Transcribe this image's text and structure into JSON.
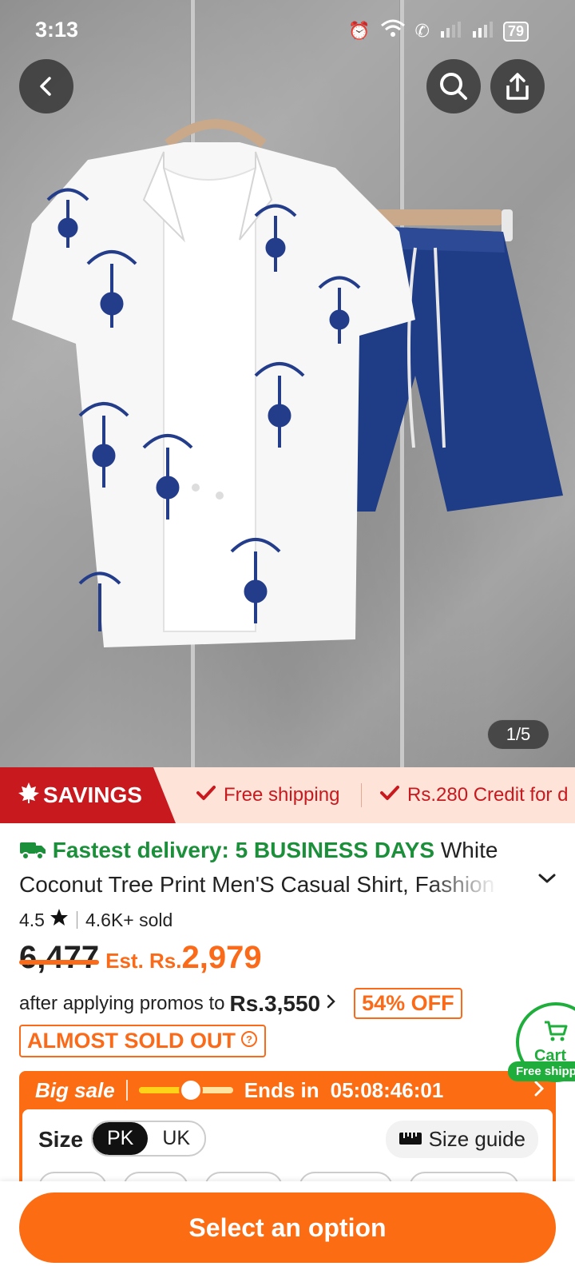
{
  "status_bar": {
    "time": "3:13",
    "battery": "79"
  },
  "gallery": {
    "counter": "1/5"
  },
  "savings_strip": {
    "tag": "SAVINGS",
    "items": [
      "Free shipping",
      "Rs.280 Credit for d"
    ]
  },
  "product": {
    "delivery_label": "Fastest delivery:",
    "delivery_value": "5 BUSINESS DAYS",
    "title_part1": "White",
    "title_part2": "Coconut Tree Print Men'S Casual Shirt, Fashion",
    "rating": "4.5",
    "sold": "4.6K+ sold",
    "old_price": "6,477",
    "est_label": "Est. Rs.",
    "est_price": "2,979",
    "promo_text": "after applying promos to",
    "promo_price": "Rs.3,550",
    "discount": "54% OFF",
    "stock_status": "ALMOST SOLD OUT"
  },
  "cart_float": {
    "label": "Cart",
    "badge": "Free shipp"
  },
  "sale": {
    "title": "Big sale",
    "progress": 0.55,
    "ends_label": "Ends in",
    "countdown": "05:08:46:01"
  },
  "size_section": {
    "label": "Size",
    "regions": [
      "PK",
      "UK"
    ],
    "selected_region": "PK",
    "guide_label": "Size guide"
  },
  "cta": {
    "label": "Select an option"
  },
  "colors": {
    "accent": "#fb6c13",
    "savings_red": "#c8191f",
    "delivery_green": "#1b8f3a"
  }
}
